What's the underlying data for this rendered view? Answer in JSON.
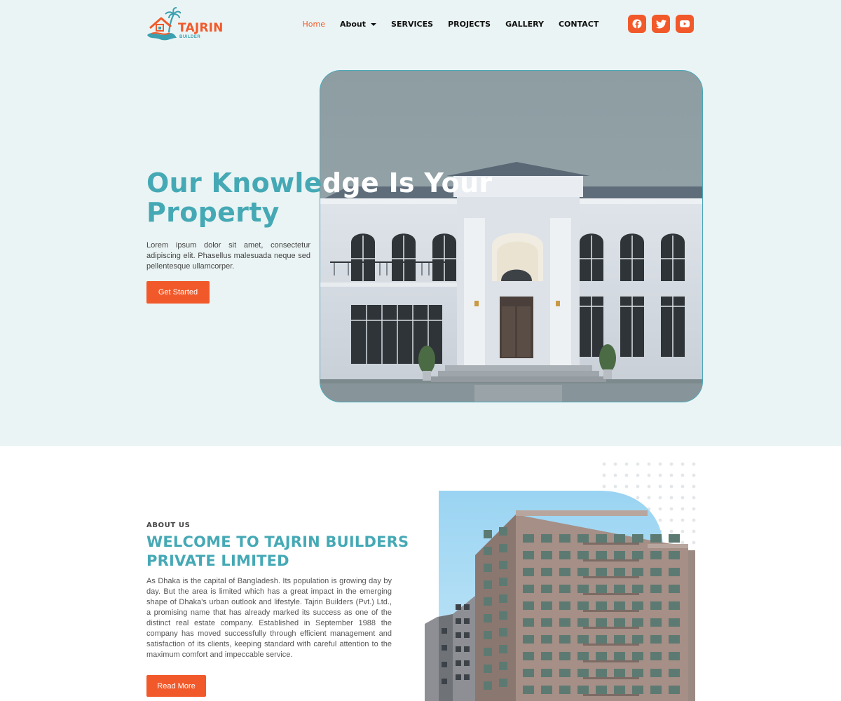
{
  "brand": {
    "name": "TAJRIN",
    "sub": "BUILDER"
  },
  "nav": {
    "items": [
      {
        "label": "Home",
        "active": true
      },
      {
        "label": "About",
        "dropdown": true
      },
      {
        "label": "SERVICES"
      },
      {
        "label": "PROJECTS"
      },
      {
        "label": "GALLERY"
      },
      {
        "label": "CONTACT"
      }
    ]
  },
  "socials": [
    "facebook-icon",
    "twitter-icon",
    "youtube-icon"
  ],
  "hero": {
    "title_part1": "Our Knowle",
    "title_part2": "dge Is Your",
    "title_line2": "Property",
    "text": "Lorem ipsum dolor sit amet, consectetur adipiscing elit. Phasellus malesuada neque sed pellentesque ullamcorper.",
    "button": "Get Started"
  },
  "about": {
    "eyebrow": "ABOUT US",
    "title": "WELCOME TO TAJRIN BUILDERS PRIVATE LIMITED",
    "text": "As Dhaka is the capital of Bangladesh. Its population is growing day by day. But the area is limited which has a great impact in the emerging shape of Dhaka's urban outlook and lifestyle. Tajrin Builders (Pvt.) Ltd., a promising name that has already marked its success as one of the distinct real estate company. Established in September 1988 the company has moved successfully through efficient management and satisfaction of its clients, keeping standard with careful attention to the maximum comfort and impeccable service.",
    "button": "Read More"
  },
  "colors": {
    "accent": "#f2592a",
    "teal": "#45a9b5",
    "hero_bg": "#ebf4f4"
  }
}
